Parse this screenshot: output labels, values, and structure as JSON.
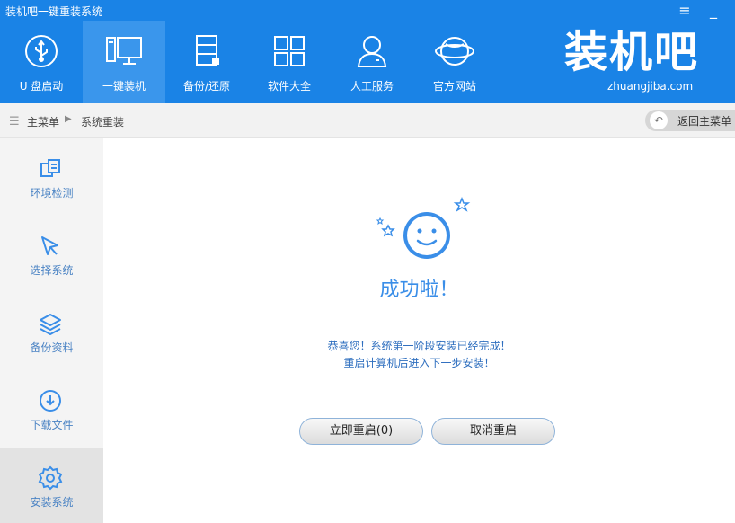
{
  "window": {
    "title": "装机吧一键重装系统",
    "menu_glyph": "≡",
    "min_glyph": "_"
  },
  "nav": {
    "items": [
      {
        "label": "U 盘启动",
        "icon": "usb-icon"
      },
      {
        "label": "一键装机",
        "icon": "monitor-icon",
        "active": true
      },
      {
        "label": "备份/还原",
        "icon": "backup-icon"
      },
      {
        "label": "软件大全",
        "icon": "apps-grid-icon"
      },
      {
        "label": "人工服务",
        "icon": "support-person-icon"
      },
      {
        "label": "官方网站",
        "icon": "globe-icon"
      }
    ]
  },
  "logo": {
    "text": "装机吧",
    "domain": "zhuangjiba.com"
  },
  "breadcrumb": {
    "home": "主菜单",
    "separator": "▶",
    "current": "系统重装",
    "back_label": "返回主菜单"
  },
  "sidebar": {
    "items": [
      {
        "label": "环境检测",
        "icon": "copy-pages-icon"
      },
      {
        "label": "选择系统",
        "icon": "cursor-icon"
      },
      {
        "label": "备份资料",
        "icon": "layers-icon"
      },
      {
        "label": "下载文件",
        "icon": "download-icon"
      },
      {
        "label": "安装系统",
        "icon": "gear-icon",
        "active": true
      }
    ]
  },
  "main": {
    "title": "成功啦！",
    "message_line1": "恭喜您！系统第一阶段安装已经完成！",
    "message_line2": "重启计算机后进入下一步安装！",
    "restart_button": "立即重启(0)",
    "cancel_button": "取消重启"
  },
  "colors": {
    "header": "#1a83e6",
    "header_active": "#3a96ec",
    "accent": "#3a8ee8",
    "sidebar": "#f4f4f4"
  }
}
